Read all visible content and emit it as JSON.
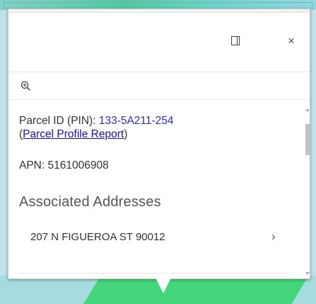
{
  "popup": {
    "dock_icon": "dock-panel-icon",
    "close_label": "×",
    "zoom_icon": "zoom-in-icon"
  },
  "parcel": {
    "pin_label": "Parcel ID (PIN): ",
    "pin_value": "133-5A211-254",
    "report_open": "(",
    "report_link": "Parcel Profile Report",
    "report_close": ")",
    "apn_text": "APN: 5161006908"
  },
  "addresses": {
    "title": "Associated Addresses",
    "items": [
      {
        "text": "207 N FIGUEROA ST 90012",
        "chevron": "›"
      }
    ]
  },
  "colors": {
    "link": "#1a0dab",
    "pin": "#2a2ad6",
    "map_green": "#44d67a",
    "map_teal": "#a6dcdf"
  }
}
